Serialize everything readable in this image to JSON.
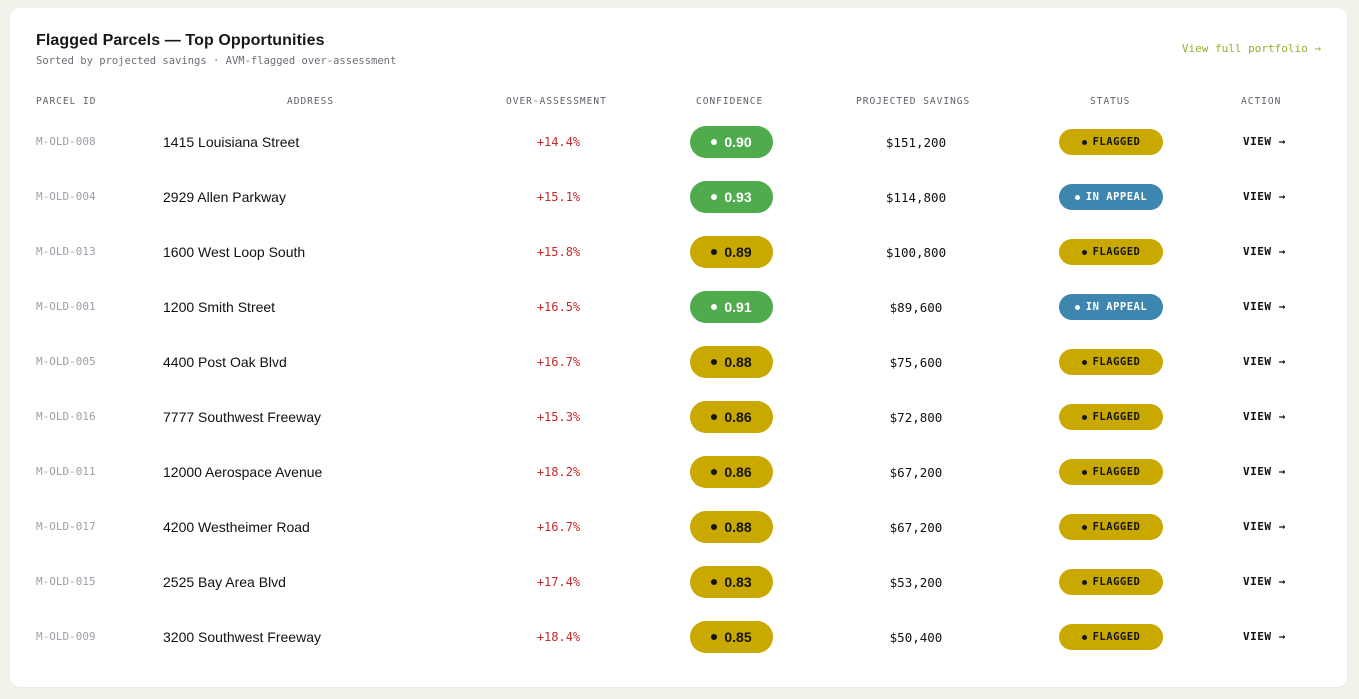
{
  "card": {
    "title": "Flagged Parcels — Top Opportunities",
    "subtitle": "Sorted by projected savings · AVM-flagged over-assessment",
    "portfolio_link": "View full portfolio →"
  },
  "columns": {
    "parcel_id": "PARCEL ID",
    "address": "ADDRESS",
    "over_assessment": "OVER-ASSESSMENT",
    "confidence": "CONFIDENCE",
    "projected_savings": "PROJECTED SAVINGS",
    "status": "STATUS",
    "action": "ACTION"
  },
  "colors": {
    "confidence_high": "#4fab4c",
    "confidence_medium": "#c9a800",
    "status_flagged": "#c9a800",
    "status_in_appeal": "#3d86b0",
    "over_assessment_text": "#c62a2a",
    "link": "#8fb22c"
  },
  "rows": [
    {
      "id": "M-OLD-008",
      "address": "1415 Louisiana Street",
      "over": "+14.4%",
      "confidence": "0.90",
      "confidence_level": "high",
      "savings": "$151,200",
      "status": "FLAGGED",
      "status_type": "flagged",
      "action": "VIEW →"
    },
    {
      "id": "M-OLD-004",
      "address": "2929 Allen Parkway",
      "over": "+15.1%",
      "confidence": "0.93",
      "confidence_level": "high",
      "savings": "$114,800",
      "status": "IN APPEAL",
      "status_type": "appeal",
      "action": "VIEW →"
    },
    {
      "id": "M-OLD-013",
      "address": "1600 West Loop South",
      "over": "+15.8%",
      "confidence": "0.89",
      "confidence_level": "medium",
      "savings": "$100,800",
      "status": "FLAGGED",
      "status_type": "flagged",
      "action": "VIEW →"
    },
    {
      "id": "M-OLD-001",
      "address": "1200 Smith Street",
      "over": "+16.5%",
      "confidence": "0.91",
      "confidence_level": "high",
      "savings": "$89,600",
      "status": "IN APPEAL",
      "status_type": "appeal",
      "action": "VIEW →"
    },
    {
      "id": "M-OLD-005",
      "address": "4400 Post Oak Blvd",
      "over": "+16.7%",
      "confidence": "0.88",
      "confidence_level": "medium",
      "savings": "$75,600",
      "status": "FLAGGED",
      "status_type": "flagged",
      "action": "VIEW →"
    },
    {
      "id": "M-OLD-016",
      "address": "7777 Southwest Freeway",
      "over": "+15.3%",
      "confidence": "0.86",
      "confidence_level": "medium",
      "savings": "$72,800",
      "status": "FLAGGED",
      "status_type": "flagged",
      "action": "VIEW →"
    },
    {
      "id": "M-OLD-011",
      "address": "12000 Aerospace Avenue",
      "over": "+18.2%",
      "confidence": "0.86",
      "confidence_level": "medium",
      "savings": "$67,200",
      "status": "FLAGGED",
      "status_type": "flagged",
      "action": "VIEW →"
    },
    {
      "id": "M-OLD-017",
      "address": "4200 Westheimer Road",
      "over": "+16.7%",
      "confidence": "0.88",
      "confidence_level": "medium",
      "savings": "$67,200",
      "status": "FLAGGED",
      "status_type": "flagged",
      "action": "VIEW →"
    },
    {
      "id": "M-OLD-015",
      "address": "2525 Bay Area Blvd",
      "over": "+17.4%",
      "confidence": "0.83",
      "confidence_level": "medium",
      "savings": "$53,200",
      "status": "FLAGGED",
      "status_type": "flagged",
      "action": "VIEW →"
    },
    {
      "id": "M-OLD-009",
      "address": "3200 Southwest Freeway",
      "over": "+18.4%",
      "confidence": "0.85",
      "confidence_level": "medium",
      "savings": "$50,400",
      "status": "FLAGGED",
      "status_type": "flagged",
      "action": "VIEW →"
    }
  ]
}
